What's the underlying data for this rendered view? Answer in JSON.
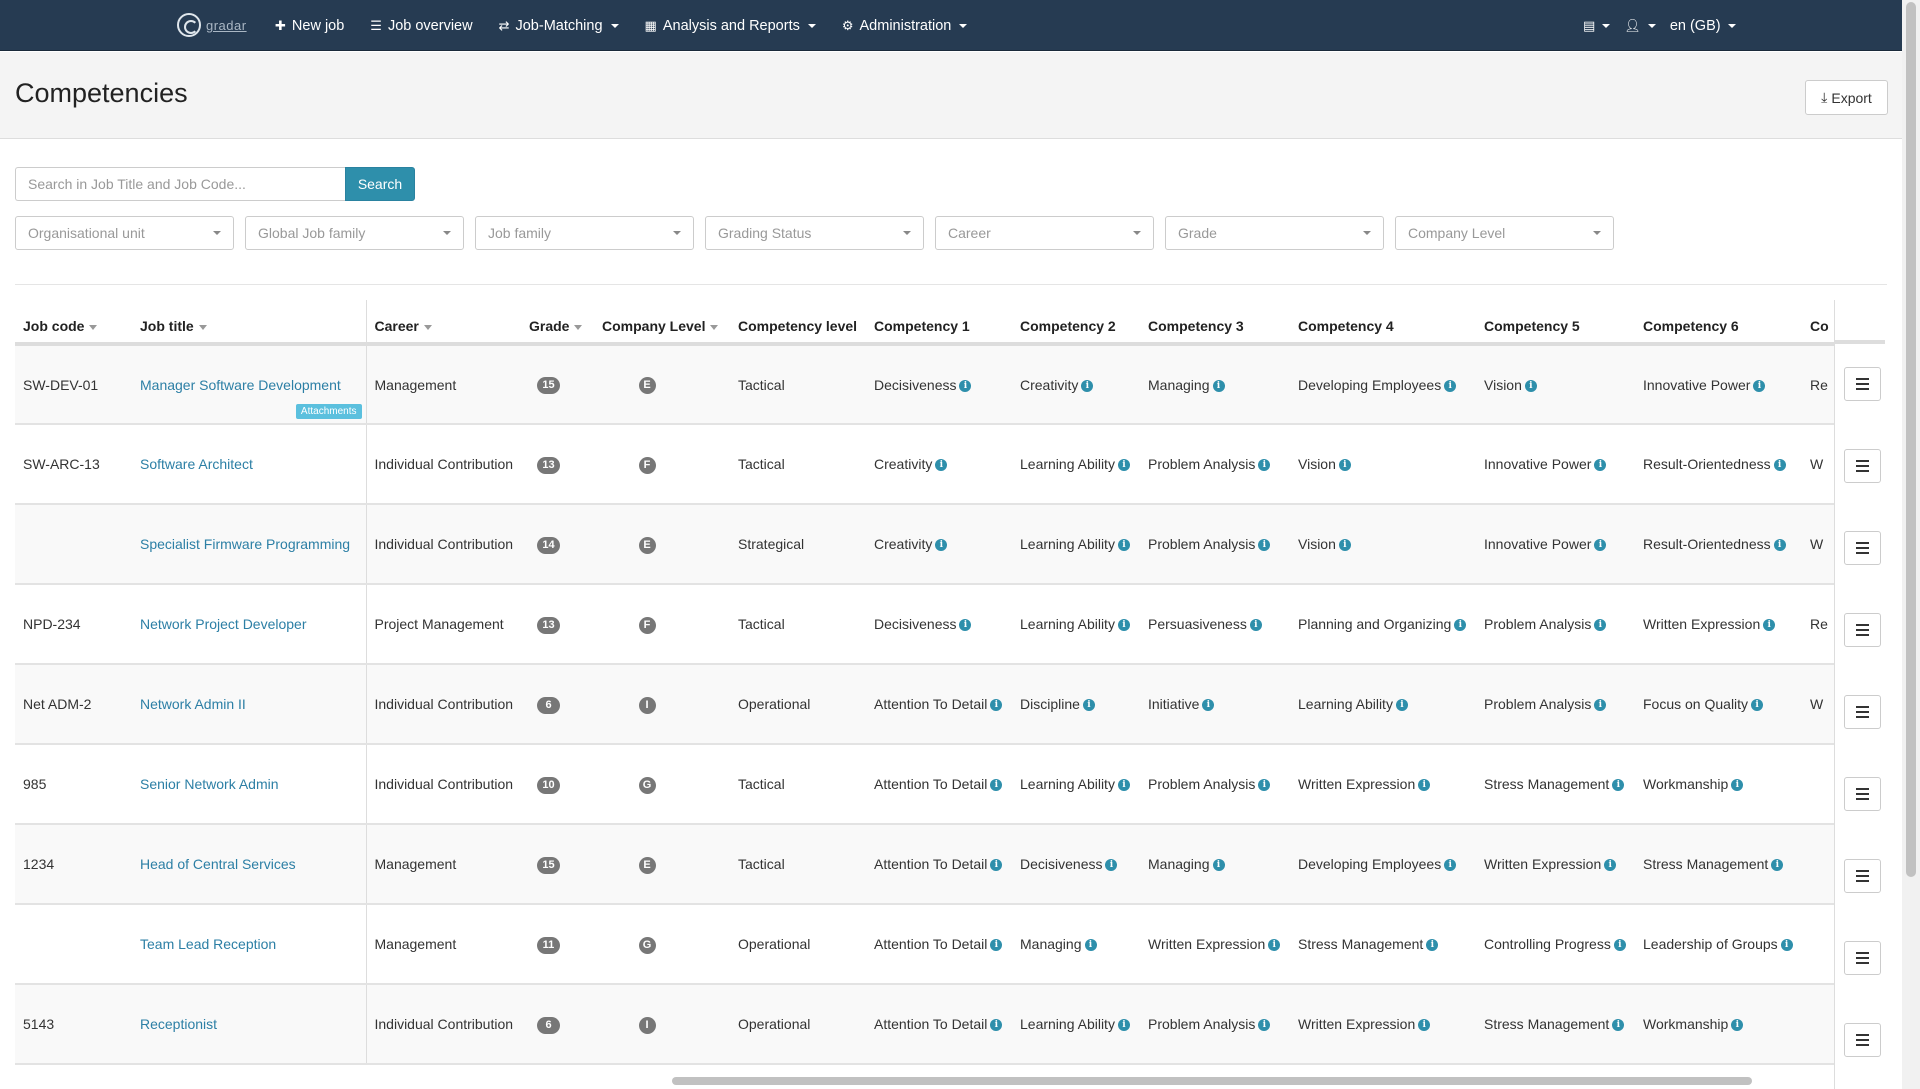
{
  "navbar": {
    "brand": "gradar",
    "items": [
      {
        "label": "New job",
        "icon": "plus-icon",
        "dropdown": false
      },
      {
        "label": "Job overview",
        "icon": "list-icon",
        "dropdown": false
      },
      {
        "label": "Job-Matching",
        "icon": "exchange-icon",
        "dropdown": true
      },
      {
        "label": "Analysis and Reports",
        "icon": "table-icon",
        "dropdown": true
      },
      {
        "label": "Administration",
        "icon": "gear-icon",
        "dropdown": true
      }
    ],
    "right": {
      "book_icon": "book-icon",
      "user_icon": "user-icon",
      "language": "en (GB)"
    }
  },
  "header": {
    "title": "Competencies",
    "export_label": "Export"
  },
  "search": {
    "placeholder": "Search in Job Title and Job Code...",
    "value": "",
    "button_label": "Search"
  },
  "filters": [
    {
      "placeholder": "Organisational unit"
    },
    {
      "placeholder": "Global Job family"
    },
    {
      "placeholder": "Job family"
    },
    {
      "placeholder": "Grading Status"
    },
    {
      "placeholder": "Career"
    },
    {
      "placeholder": "Grade"
    },
    {
      "placeholder": "Company Level"
    }
  ],
  "table": {
    "columns": [
      {
        "label": "Job code",
        "sortable": true
      },
      {
        "label": "Job title",
        "sortable": true
      },
      {
        "label": "Career",
        "sortable": true
      },
      {
        "label": "Grade",
        "sortable": true
      },
      {
        "label": "Company Level",
        "sortable": true
      },
      {
        "label": "Competency level",
        "sortable": false
      },
      {
        "label": "Competency 1",
        "sortable": false
      },
      {
        "label": "Competency 2",
        "sortable": false
      },
      {
        "label": "Competency 3",
        "sortable": false
      },
      {
        "label": "Competency 4",
        "sortable": false
      },
      {
        "label": "Competency 5",
        "sortable": false
      },
      {
        "label": "Competency 6",
        "sortable": false
      },
      {
        "label": "Co",
        "sortable": false
      }
    ],
    "attachments_label": "Attachments",
    "rows": [
      {
        "code": "SW-DEV-01",
        "title": "Manager Software Development",
        "attachments": true,
        "career": "Management",
        "grade": "15",
        "level": "E",
        "comp_level": "Tactical",
        "competencies": [
          "Decisiveness",
          "Creativity",
          "Managing",
          "Developing Employees",
          "Vision",
          "Innovative Power"
        ],
        "c7": "Re"
      },
      {
        "code": "SW-ARC-13",
        "title": "Software Architect",
        "attachments": false,
        "career": "Individual Contribution",
        "grade": "13",
        "level": "F",
        "comp_level": "Tactical",
        "competencies": [
          "Creativity",
          "Learning Ability",
          "Problem Analysis",
          "Vision",
          "Innovative Power",
          "Result-Orientedness"
        ],
        "c7": "W"
      },
      {
        "code": "",
        "title": "Specialist Firmware Programming",
        "attachments": false,
        "career": "Individual Contribution",
        "grade": "14",
        "level": "E",
        "comp_level": "Strategical",
        "competencies": [
          "Creativity",
          "Learning Ability",
          "Problem Analysis",
          "Vision",
          "Innovative Power",
          "Result-Orientedness"
        ],
        "c7": "W"
      },
      {
        "code": "NPD-234",
        "title": "Network Project Developer",
        "attachments": false,
        "career": "Project Management",
        "grade": "13",
        "level": "F",
        "comp_level": "Tactical",
        "competencies": [
          "Decisiveness",
          "Learning Ability",
          "Persuasiveness",
          "Planning and Organizing",
          "Problem Analysis",
          "Written Expression"
        ],
        "c7": "Re"
      },
      {
        "code": "Net ADM-2",
        "title": "Network Admin II",
        "attachments": false,
        "career": "Individual Contribution",
        "grade": "6",
        "level": "I",
        "comp_level": "Operational",
        "competencies": [
          "Attention To Detail",
          "Discipline",
          "Initiative",
          "Learning Ability",
          "Problem Analysis",
          "Focus on Quality"
        ],
        "c7": "W"
      },
      {
        "code": "985",
        "title": "Senior Network Admin",
        "attachments": false,
        "career": "Individual Contribution",
        "grade": "10",
        "level": "G",
        "comp_level": "Tactical",
        "competencies": [
          "Attention To Detail",
          "Learning Ability",
          "Problem Analysis",
          "Written Expression",
          "Stress Management",
          "Workmanship"
        ],
        "c7": ""
      },
      {
        "code": "1234",
        "title": "Head of Central Services",
        "attachments": false,
        "career": "Management",
        "grade": "15",
        "level": "E",
        "comp_level": "Tactical",
        "competencies": [
          "Attention To Detail",
          "Decisiveness",
          "Managing",
          "Developing Employees",
          "Written Expression",
          "Stress Management"
        ],
        "c7": ""
      },
      {
        "code": "",
        "title": "Team Lead Reception",
        "attachments": false,
        "career": "Management",
        "grade": "11",
        "level": "G",
        "comp_level": "Operational",
        "competencies": [
          "Attention To Detail",
          "Managing",
          "Written Expression",
          "Stress Management",
          "Controlling Progress",
          "Leadership of Groups"
        ],
        "c7": ""
      },
      {
        "code": "5143",
        "title": "Receptionist",
        "attachments": false,
        "career": "Individual Contribution",
        "grade": "6",
        "level": "I",
        "comp_level": "Operational",
        "competencies": [
          "Attention To Detail",
          "Learning Ability",
          "Problem Analysis",
          "Written Expression",
          "Stress Management",
          "Workmanship"
        ],
        "c7": ""
      }
    ]
  },
  "colors": {
    "navbar": "#263b52",
    "accent": "#2e8fab",
    "link": "#2c7fa5",
    "badge": "#777777",
    "attachments_badge": "#5bc0de"
  }
}
